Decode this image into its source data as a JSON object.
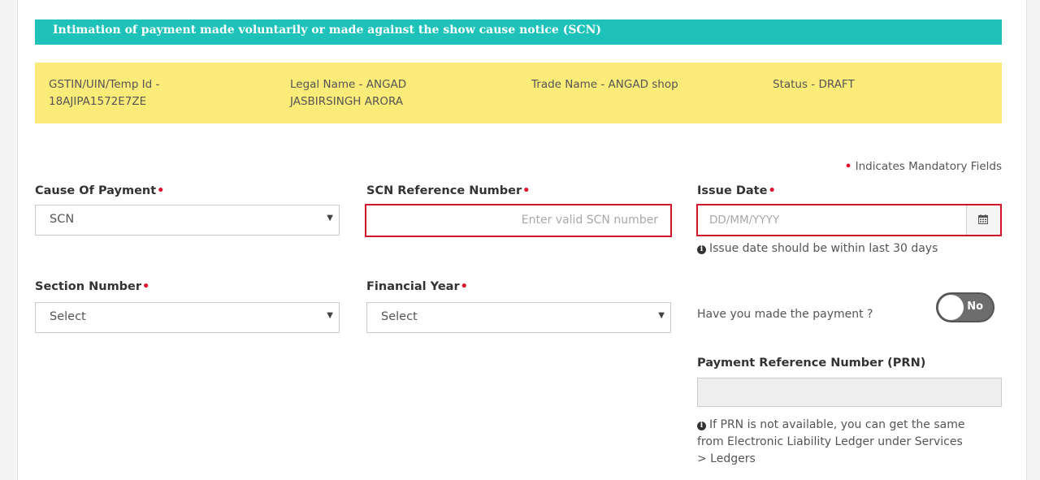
{
  "header": {
    "title": "Intimation of payment made voluntarily or made against the show cause notice (SCN)"
  },
  "taxpayer": {
    "gstin_label": "GSTIN/UIN/Temp Id -",
    "gstin_value": "18AJIPA1572E7ZE",
    "legal_name_line1": "Legal Name - ANGAD",
    "legal_name_line2": "JASBIRSINGH ARORA",
    "trade_name": "Trade Name - ANGAD shop",
    "status": "Status - DRAFT"
  },
  "form": {
    "mandatory_marker": "•",
    "mandatory_note": "Indicates Mandatory Fields",
    "cause_of_payment": {
      "label": "Cause Of Payment",
      "value": "SCN"
    },
    "scn_reference": {
      "label": "SCN Reference Number",
      "placeholder": "Enter valid SCN number"
    },
    "issue_date": {
      "label": "Issue Date",
      "placeholder": "DD/MM/YYYY",
      "hint": "Issue date should be within last 30 days"
    },
    "section_number": {
      "label": "Section Number",
      "value": "Select"
    },
    "financial_year": {
      "label": "Financial Year",
      "value": "Select"
    },
    "payment_made": {
      "question": "Have you made the payment ?",
      "toggle_label": "No"
    },
    "prn": {
      "label": "Payment Reference Number (PRN)",
      "value": "",
      "hint_line1": "If PRN is not available, you can get the same",
      "hint_line2": "from Electronic Liability Ledger under Services",
      "hint_line3": "> Ledgers"
    }
  },
  "icons": {
    "dropdown": "caret-down-icon",
    "calendar": "calendar-icon",
    "info": "info-circle-icon"
  },
  "colors": {
    "title_bar": "#1ec2b8",
    "info_bar": "#fbeb78",
    "error_border": "#d2132a",
    "mandatory": "#e0102b",
    "toggle_off": "#6d6d6d"
  }
}
